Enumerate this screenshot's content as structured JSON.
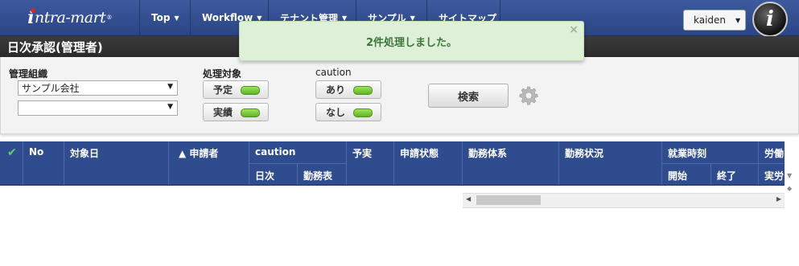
{
  "nav": {
    "logo_text": "intra-mart",
    "logo_mark": "®",
    "items": [
      {
        "label": "Top"
      },
      {
        "label": "Workflow"
      },
      {
        "label": "テナント管理"
      },
      {
        "label": "サンプル"
      },
      {
        "label": "サイトマップ"
      }
    ],
    "user": "kaiden",
    "badge_letter": "i"
  },
  "title": "日次承認(管理者)",
  "notice": {
    "message": "2件処理しました。",
    "close": "×"
  },
  "filters": {
    "org_label": "管理組織",
    "org_value": "サンプル会社",
    "org_value2": "",
    "target_label": "処理対象",
    "target_plan": "予定",
    "target_actual": "実績",
    "caution_label": "caution",
    "caution_yes": "あり",
    "caution_no": "なし",
    "search_label": "検索"
  },
  "grid": {
    "check": "✔",
    "columns": {
      "no": "No",
      "date": "対象日",
      "applicant": "▲ 申請者",
      "caution": "caution",
      "caution_daily": "日次",
      "caution_sheet": "勤務表",
      "plan_actual": "予実",
      "status": "申請状態",
      "system": "勤務体系",
      "work_status": "勤務状況",
      "work_time": "就業時刻",
      "start": "開始",
      "end": "終了",
      "labor": "労働",
      "actual": "実労"
    }
  }
}
